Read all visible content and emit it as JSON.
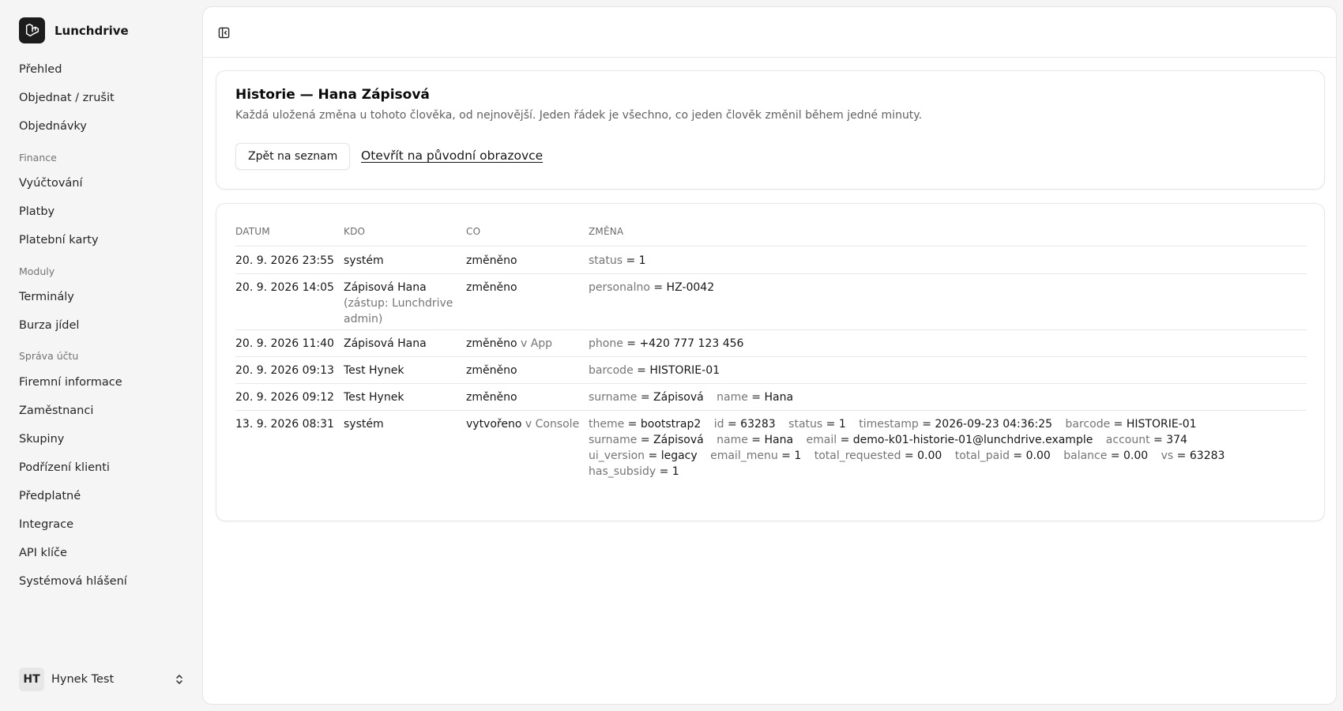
{
  "app": {
    "name": "Lunchdrive"
  },
  "sidebar": {
    "top_items": [
      {
        "label": "Přehled"
      },
      {
        "label": "Objednat / zrušit"
      },
      {
        "label": "Objednávky"
      }
    ],
    "groups": [
      {
        "label": "Finance",
        "items": [
          {
            "label": "Vyúčtování"
          },
          {
            "label": "Platby"
          },
          {
            "label": "Platební karty"
          }
        ]
      },
      {
        "label": "Moduly",
        "items": [
          {
            "label": "Terminály"
          },
          {
            "label": "Burza jídel"
          }
        ]
      },
      {
        "label": "Správa účtu",
        "items": [
          {
            "label": "Firemní informace"
          },
          {
            "label": "Zaměstnanci"
          },
          {
            "label": "Skupiny"
          },
          {
            "label": "Podřízení klienti"
          },
          {
            "label": "Předplatné"
          },
          {
            "label": "Integrace"
          },
          {
            "label": "API klíče"
          },
          {
            "label": "Systémová hlášení"
          }
        ]
      }
    ],
    "user": {
      "initials": "HT",
      "name": "Hynek Test"
    }
  },
  "page": {
    "title": "Historie — Hana Zápisová",
    "subtitle": "Každá uložená změna u tohoto člověka, od nejnovější. Jeden řádek je všechno, co jeden člověk změnil během jedné minuty.",
    "back_button": "Zpět na seznam",
    "open_link": "Otevřít na původní obrazovce"
  },
  "history": {
    "columns": {
      "date": "DATUM",
      "who": "KDO",
      "what": "CO",
      "change": "ZMĚNA"
    },
    "rows": [
      {
        "date": "20. 9. 2026 23:55",
        "who": "systém",
        "who_note": "",
        "what": "změněno",
        "source": "",
        "changes": [
          {
            "k": "status",
            "v": "1"
          }
        ]
      },
      {
        "date": "20. 9. 2026 14:05",
        "who": "Zápisová Hana",
        "who_note": "(zástup: Lunchdrive admin)",
        "what": "změněno",
        "source": "",
        "changes": [
          {
            "k": "personalno",
            "v": "HZ-0042"
          }
        ]
      },
      {
        "date": "20. 9. 2026 11:40",
        "who": "Zápisová Hana",
        "who_note": "",
        "what": "změněno",
        "source": "v App",
        "changes": [
          {
            "k": "phone",
            "v": "+420 777 123 456"
          }
        ]
      },
      {
        "date": "20. 9. 2026 09:13",
        "who": "Test Hynek",
        "who_note": "",
        "what": "změněno",
        "source": "",
        "changes": [
          {
            "k": "barcode",
            "v": "HISTORIE-01"
          }
        ]
      },
      {
        "date": "20. 9. 2026 09:12",
        "who": "Test Hynek",
        "who_note": "",
        "what": "změněno",
        "source": "",
        "changes": [
          {
            "k": "surname",
            "v": "Zápisová"
          },
          {
            "k": "name",
            "v": "Hana"
          }
        ]
      },
      {
        "date": "13. 9. 2026 08:31",
        "who": "systém",
        "who_note": "",
        "what": "vytvořeno",
        "source": "v Console",
        "changes": [
          {
            "k": "theme",
            "v": "bootstrap2"
          },
          {
            "k": "id",
            "v": "63283"
          },
          {
            "k": "status",
            "v": "1"
          },
          {
            "k": "timestamp",
            "v": "2026-09-23 04:36:25"
          },
          {
            "k": "barcode",
            "v": "HISTORIE-01"
          },
          {
            "k": "surname",
            "v": "Zápisová"
          },
          {
            "k": "name",
            "v": "Hana"
          },
          {
            "k": "email",
            "v": "demo-k01-historie-01@lunchdrive.example"
          },
          {
            "k": "account",
            "v": "374"
          },
          {
            "k": "ui_version",
            "v": "legacy"
          },
          {
            "k": "email_menu",
            "v": "1"
          },
          {
            "k": "total_requested",
            "v": "0.00"
          },
          {
            "k": "total_paid",
            "v": "0.00"
          },
          {
            "k": "balance",
            "v": "0.00"
          },
          {
            "k": "vs",
            "v": "63283"
          },
          {
            "k": "has_subsidy",
            "v": "1"
          }
        ]
      }
    ]
  }
}
